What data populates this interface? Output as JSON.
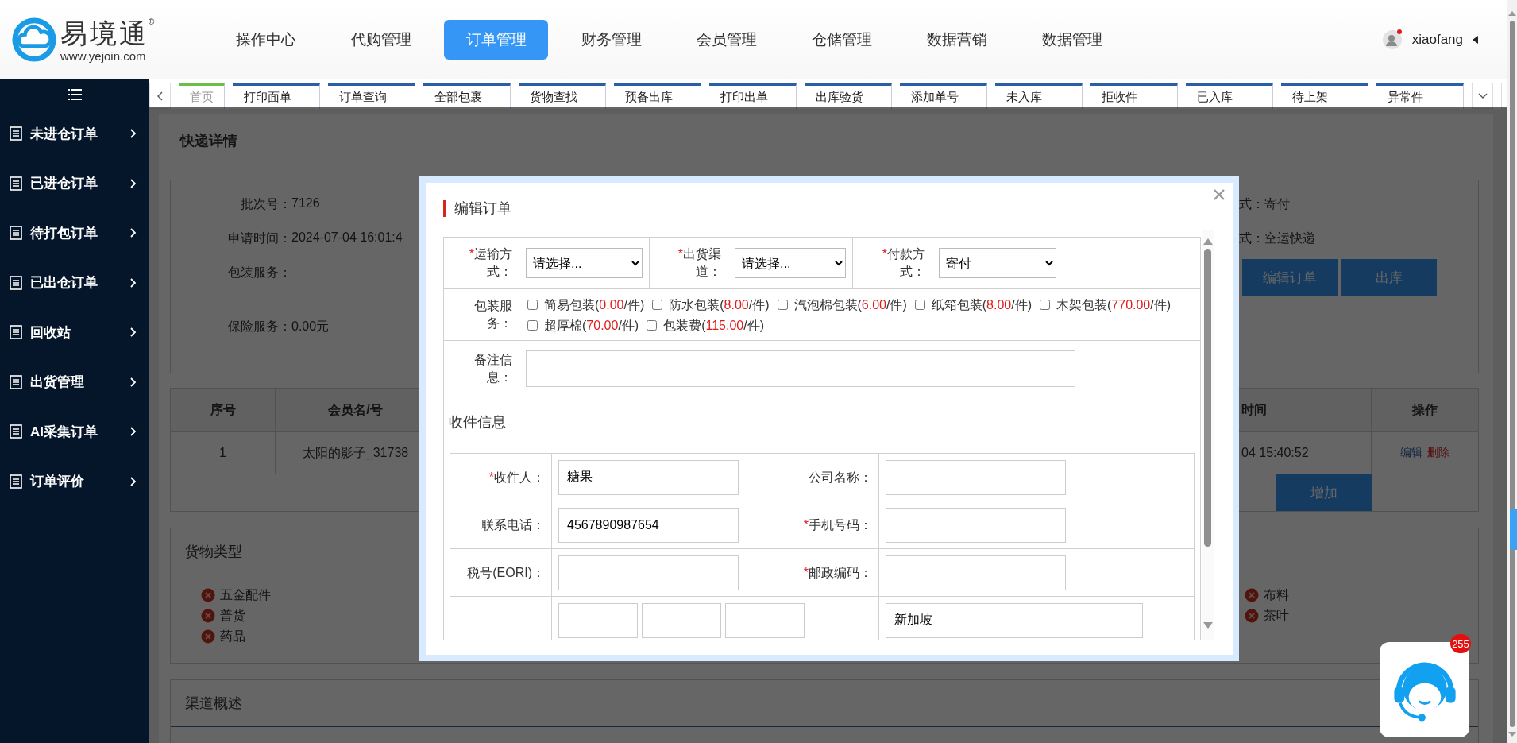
{
  "logo": {
    "name": "易境通",
    "registered": "®",
    "url": "www.yejoin.com"
  },
  "nav": [
    {
      "label": "操作中心",
      "selected": false
    },
    {
      "label": "代购管理",
      "selected": false
    },
    {
      "label": "订单管理",
      "selected": true
    },
    {
      "label": "财务管理",
      "selected": false
    },
    {
      "label": "会员管理",
      "selected": false
    },
    {
      "label": "仓储管理",
      "selected": false
    },
    {
      "label": "数据营销",
      "selected": false
    },
    {
      "label": "数据管理",
      "selected": false
    }
  ],
  "user": {
    "name": "xiaofang",
    "alert": true
  },
  "sidebar": {
    "items": [
      {
        "label": "未进仓订单"
      },
      {
        "label": "已进仓订单"
      },
      {
        "label": "待打包订单"
      },
      {
        "label": "已出仓订单"
      },
      {
        "label": "回收站"
      },
      {
        "label": "出货管理"
      },
      {
        "label": "AI采集订单"
      },
      {
        "label": "订单评价"
      }
    ]
  },
  "tabs": [
    {
      "label": "首页",
      "selected": true
    },
    {
      "label": "打印面单",
      "selected": false
    },
    {
      "label": "订单查询",
      "selected": false
    },
    {
      "label": "全部包裹",
      "selected": false
    },
    {
      "label": "货物查找",
      "selected": false
    },
    {
      "label": "预备出库",
      "selected": false
    },
    {
      "label": "打印出单",
      "selected": false
    },
    {
      "label": "出库验货",
      "selected": false
    },
    {
      "label": "添加单号",
      "selected": false
    },
    {
      "label": "未入库",
      "selected": false
    },
    {
      "label": "拒收件",
      "selected": false
    },
    {
      "label": "已入库",
      "selected": false
    },
    {
      "label": "待上架",
      "selected": false
    },
    {
      "label": "异常件",
      "selected": false
    }
  ],
  "page": {
    "title": "快递详情",
    "info_left": [
      {
        "label": "批次号：",
        "value": "7126"
      },
      {
        "label": "申请时间：",
        "value": "2024-07-04 16:01:4"
      },
      {
        "label": "包装服务：",
        "kind": "tall"
      },
      {
        "label": "保险服务：",
        "value": "0.00元"
      }
    ],
    "info_right": [
      {
        "label": "式：",
        "value": "寄付"
      },
      {
        "label": "式：",
        "value": "空运快递"
      }
    ],
    "actions": [
      "编辑订单",
      "出库"
    ],
    "table": {
      "columns": [
        "序号",
        "会员名/号",
        "时间",
        "操作"
      ],
      "rows": [
        {
          "cells": [
            "1",
            "太阳的影子_31738",
            "04 15:40:52"
          ],
          "links": [
            {
              "label": "编辑",
              "kind": "edit"
            },
            {
              "label": "删除",
              "kind": "delete"
            }
          ]
        }
      ]
    },
    "add_button": "增加",
    "cargo": {
      "title": "货物类型",
      "left": [
        "五金配件",
        "普货",
        "药品"
      ],
      "right": [
        "布料",
        "茶叶"
      ]
    },
    "channel": {
      "title": "渠道概述"
    }
  },
  "modal": {
    "title": "编辑订单",
    "selects": [
      {
        "mark": "*",
        "label": "运输方式：",
        "value": "请选择..."
      },
      {
        "mark": "*",
        "label": "出货渠道：",
        "value": "请选择..."
      },
      {
        "mark": "*",
        "label": "付款方式：",
        "value": "寄付"
      }
    ],
    "packaging": {
      "label": "包装服务：",
      "options": [
        {
          "name": "简易包装(",
          "price": "0.00",
          "suffix": "/件)",
          "checked": false
        },
        {
          "name": "防水包装(",
          "price": "8.00",
          "suffix": "/件)",
          "checked": false
        },
        {
          "name": "汽泡棉包装(",
          "price": "6.00",
          "suffix": "/件)",
          "checked": false
        },
        {
          "name": "纸箱包装(",
          "price": "8.00",
          "suffix": "/件)",
          "checked": false
        },
        {
          "name": "木架包装(",
          "price": "770.00",
          "suffix": "/件)",
          "checked": false
        },
        {
          "name": "超厚棉(",
          "price": "70.00",
          "suffix": "/件)",
          "checked": false
        },
        {
          "name": "包装费(",
          "price": "115.00",
          "suffix": "/件)",
          "checked": false
        }
      ]
    },
    "remark": {
      "label": "备注信息："
    },
    "recipient": {
      "title": "收件信息",
      "rows": [
        [
          {
            "mark": "*",
            "label": "收件人：",
            "value": "糖果"
          },
          {
            "label": "公司名称："
          }
        ],
        [
          {
            "label": "联系电话：",
            "value": "4567890987654"
          },
          {
            "mark": "*",
            "label": "手机号码："
          }
        ],
        [
          {
            "label": "税号(EORI)："
          },
          {
            "mark": "*",
            "label": "邮政编码："
          }
        ]
      ],
      "country": "新加坡"
    }
  },
  "support": {
    "badge": "255"
  }
}
